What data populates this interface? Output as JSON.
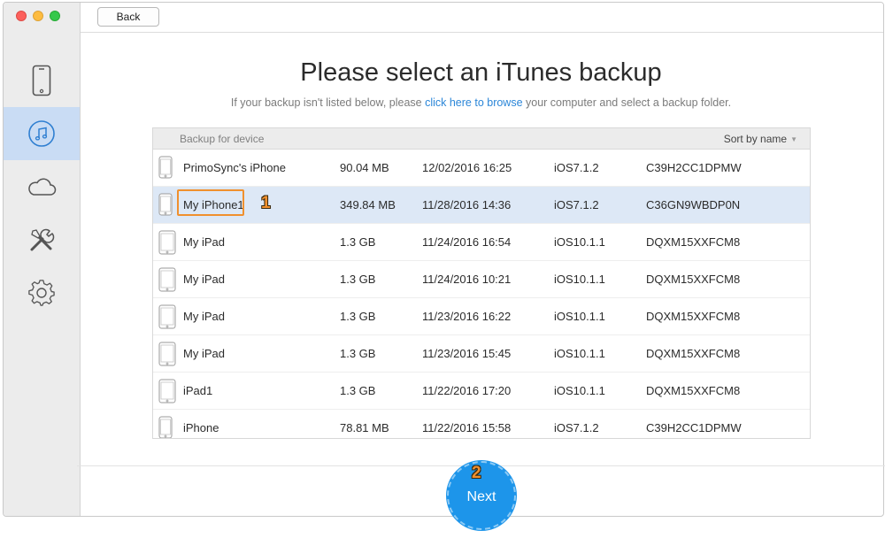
{
  "window": {
    "back_label": "Back"
  },
  "sidebar": {
    "items": [
      {
        "icon": "iphone-icon",
        "active": false
      },
      {
        "icon": "music-note-icon",
        "active": true
      },
      {
        "icon": "cloud-icon",
        "active": false
      },
      {
        "icon": "tools-icon",
        "active": false
      },
      {
        "icon": "gear-icon",
        "active": false
      }
    ]
  },
  "main": {
    "title": "Please select an iTunes backup",
    "subtitle_before": "If your backup isn't listed below, please ",
    "subtitle_link": "click here to browse",
    "subtitle_after": " your computer and select a backup folder.",
    "table": {
      "header_label": "Backup for device",
      "sort_label": "Sort by name",
      "rows": [
        {
          "name": "PrimoSync's iPhone",
          "size": "90.04 MB",
          "date": "12/02/2016 16:25",
          "ios": "iOS7.1.2",
          "serial": "C39H2CC1DPMW",
          "device": "iphone"
        },
        {
          "name": "My iPhone1",
          "size": "349.84 MB",
          "date": "11/28/2016 14:36",
          "ios": "iOS7.1.2",
          "serial": "C36GN9WBDP0N",
          "device": "iphone"
        },
        {
          "name": "My iPad",
          "size": "1.3 GB",
          "date": "11/24/2016 16:54",
          "ios": "iOS10.1.1",
          "serial": "DQXM15XXFCM8",
          "device": "ipad"
        },
        {
          "name": "My iPad",
          "size": "1.3 GB",
          "date": "11/24/2016 10:21",
          "ios": "iOS10.1.1",
          "serial": "DQXM15XXFCM8",
          "device": "ipad"
        },
        {
          "name": "My iPad",
          "size": "1.3 GB",
          "date": "11/23/2016 16:22",
          "ios": "iOS10.1.1",
          "serial": "DQXM15XXFCM8",
          "device": "ipad"
        },
        {
          "name": "My iPad",
          "size": "1.3 GB",
          "date": "11/23/2016 15:45",
          "ios": "iOS10.1.1",
          "serial": "DQXM15XXFCM8",
          "device": "ipad"
        },
        {
          "name": "iPad1",
          "size": "1.3 GB",
          "date": "11/22/2016 17:20",
          "ios": "iOS10.1.1",
          "serial": "DQXM15XXFCM8",
          "device": "ipad"
        },
        {
          "name": "iPhone",
          "size": "78.81 MB",
          "date": "11/22/2016 15:58",
          "ios": "iOS7.1.2",
          "serial": "C39H2CC1DPMW",
          "device": "iphone"
        }
      ],
      "selected_index": 1
    },
    "next_label": "Next",
    "step_badges": {
      "one": "1",
      "two": "2"
    }
  },
  "colors": {
    "accent": "#1d95ea",
    "link": "#2b86d8",
    "highlight": "#f0902e",
    "selected_row": "#dde8f6"
  }
}
